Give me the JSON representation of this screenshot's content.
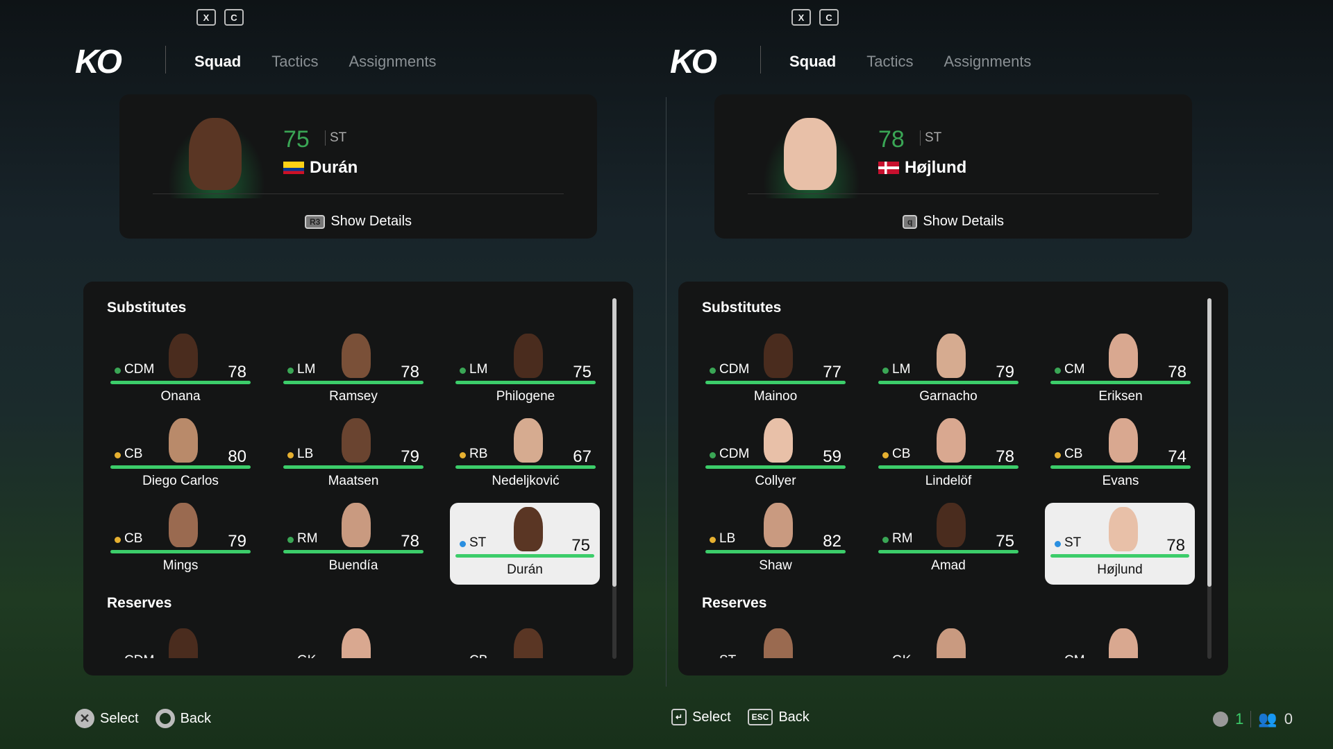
{
  "panels": [
    {
      "keys": [
        "X",
        "C"
      ],
      "logo": "KO",
      "tabs": [
        {
          "label": "Squad",
          "active": true
        },
        {
          "label": "Tactics"
        },
        {
          "label": "Assignments"
        }
      ],
      "player": {
        "rating": "75",
        "position": "ST",
        "name": "Durán",
        "flag": "colombia",
        "skin": "#5a3624",
        "details_key": "R3",
        "details_label": "Show Details"
      },
      "substitutes_title": "Substitutes",
      "reserves_title": "Reserves",
      "substitutes": [
        {
          "pos": "CDM",
          "rating": "78",
          "name": "Onana",
          "dot": "#3aa655",
          "skin": "#4a2c1e"
        },
        {
          "pos": "LM",
          "rating": "78",
          "name": "Ramsey",
          "dot": "#3aa655",
          "skin": "#7a5038"
        },
        {
          "pos": "LM",
          "rating": "75",
          "name": "Philogene",
          "dot": "#3aa655",
          "skin": "#4a2c1e"
        },
        {
          "pos": "CB",
          "rating": "80",
          "name": "Diego Carlos",
          "dot": "#e6b030",
          "skin": "#b98a6a"
        },
        {
          "pos": "LB",
          "rating": "79",
          "name": "Maatsen",
          "dot": "#e6b030",
          "skin": "#6a4430"
        },
        {
          "pos": "RB",
          "rating": "67",
          "name": "Nedeljković",
          "dot": "#e6b030",
          "skin": "#d6ab90"
        },
        {
          "pos": "CB",
          "rating": "79",
          "name": "Mings",
          "dot": "#e6b030",
          "skin": "#9a6a50"
        },
        {
          "pos": "RM",
          "rating": "78",
          "name": "Buendía",
          "dot": "#3aa655",
          "skin": "#c99a80"
        },
        {
          "pos": "ST",
          "rating": "75",
          "name": "Durán",
          "dot": "#2a8fe0",
          "skin": "#5a3624",
          "selected": true
        }
      ],
      "reserves": [
        {
          "pos": "CDM",
          "skin": "#4a2c1e"
        },
        {
          "pos": "GK",
          "skin": "#d9a890"
        },
        {
          "pos": "CB",
          "skin": "#5a3624"
        }
      ],
      "footer": [
        {
          "icon": "cross-button",
          "label": "Select"
        },
        {
          "icon": "circle-button",
          "label": "Back"
        }
      ]
    },
    {
      "keys": [
        "X",
        "C"
      ],
      "logo": "KO",
      "tabs": [
        {
          "label": "Squad",
          "active": true
        },
        {
          "label": "Tactics"
        },
        {
          "label": "Assignments"
        }
      ],
      "player": {
        "rating": "78",
        "position": "ST",
        "name": "Højlund",
        "flag": "denmark",
        "skin": "#e8c0a8",
        "details_key": "q",
        "details_label": "Show Details"
      },
      "substitutes_title": "Substitutes",
      "reserves_title": "Reserves",
      "substitutes": [
        {
          "pos": "CDM",
          "rating": "77",
          "name": "Mainoo",
          "dot": "#3aa655",
          "skin": "#4a2c1e"
        },
        {
          "pos": "LM",
          "rating": "79",
          "name": "Garnacho",
          "dot": "#3aa655",
          "skin": "#d6ab90"
        },
        {
          "pos": "CM",
          "rating": "78",
          "name": "Eriksen",
          "dot": "#3aa655",
          "skin": "#d9a890"
        },
        {
          "pos": "CDM",
          "rating": "59",
          "name": "Collyer",
          "dot": "#3aa655",
          "skin": "#e8c0a8"
        },
        {
          "pos": "CB",
          "rating": "78",
          "name": "Lindelöf",
          "dot": "#e6b030",
          "skin": "#d9a890"
        },
        {
          "pos": "CB",
          "rating": "74",
          "name": "Evans",
          "dot": "#e6b030",
          "skin": "#d9a890"
        },
        {
          "pos": "LB",
          "rating": "82",
          "name": "Shaw",
          "dot": "#e6b030",
          "skin": "#c99a80"
        },
        {
          "pos": "RM",
          "rating": "75",
          "name": "Amad",
          "dot": "#3aa655",
          "skin": "#4a2c1e"
        },
        {
          "pos": "ST",
          "rating": "78",
          "name": "Højlund",
          "dot": "#2a8fe0",
          "skin": "#e8c0a8",
          "selected": true
        }
      ],
      "reserves": [
        {
          "pos": "ST",
          "skin": "#9a6a50"
        },
        {
          "pos": "GK",
          "skin": "#c99a80"
        },
        {
          "pos": "CM",
          "skin": "#d9a890"
        }
      ],
      "footer": [
        {
          "icon": "enter-key",
          "label": "Select"
        },
        {
          "icon": "esc-key",
          "label": "Back"
        }
      ]
    }
  ],
  "status": {
    "voice_count": "1",
    "party_count": "0",
    "accent": "#3ccd6a"
  }
}
